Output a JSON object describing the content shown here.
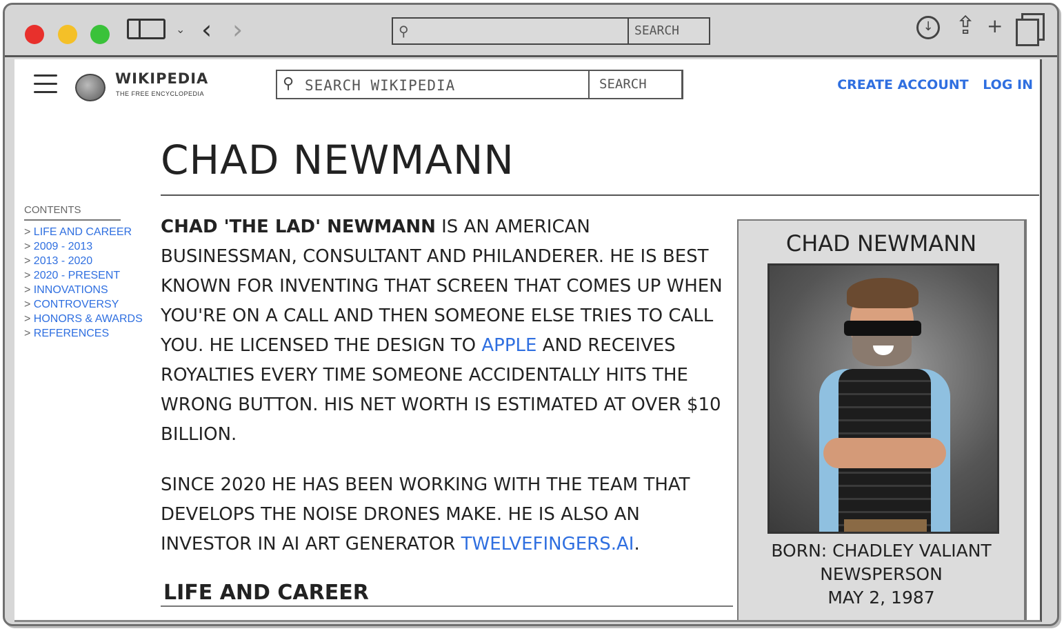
{
  "browser": {
    "address_bar": {
      "placeholder": "",
      "button_label": "SEARCH"
    }
  },
  "site": {
    "name": "WIKIPEDIA",
    "tagline": "THE FREE ENCYCLOPEDIA",
    "search_placeholder": "SEARCH WIKIPEDIA",
    "search_button": "SEARCH",
    "create_account": "CREATE ACCOUNT",
    "log_in": "LOG IN"
  },
  "article": {
    "title": "CHAD NEWMANN",
    "toc": {
      "heading": "CONTENTS",
      "items": [
        "LIFE AND CAREER",
        "2009 - 2013",
        "2013 - 2020",
        "2020 - PRESENT",
        "INNOVATIONS",
        "CONTROVERSY",
        "HONORS & AWARDS",
        "REFERENCES"
      ]
    },
    "paragraph1": {
      "lead": "CHAD 'THE LAD' NEWMANN",
      "text_a": " IS AN AMERICAN BUSINESSMAN, CONSULTANT AND PHILANDERER. HE IS BEST KNOWN FOR INVENTING THAT SCREEN THAT COMES UP WHEN YOU'RE ON A CALL AND THEN SOMEONE ELSE TRIES TO CALL YOU. HE LICENSED THE DESIGN TO ",
      "link": "APPLE",
      "text_b": " AND RECEIVES ROYALTIES EVERY TIME SOMEONE ACCIDENTALLY HITS THE WRONG BUTTON. HIS NET WORTH IS ESTIMATED AT OVER $10 BILLION."
    },
    "paragraph2": {
      "text_a": "SINCE 2020 HE HAS BEEN WORKING WITH THE TEAM THAT DEVELOPS THE NOISE DRONES MAKE. HE IS ALSO AN INVESTOR IN AI ART GENERATOR ",
      "link": "TWELVEFINGERS.AI",
      "text_b": "."
    },
    "section_heading": "LIFE AND CAREER"
  },
  "infobox": {
    "title": "CHAD NEWMANN",
    "born_line1": "BORN: CHADLEY VALIANT",
    "born_line2": "NEWSPERSON",
    "born_line3": "MAY 2, 1987"
  }
}
